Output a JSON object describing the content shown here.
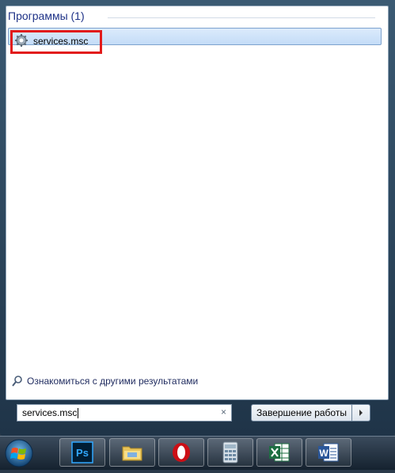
{
  "results": {
    "section_title": "Программы (1)",
    "items": [
      {
        "label": "services.msc",
        "icon": "services-gear-icon"
      }
    ]
  },
  "see_more": {
    "label": "Ознакомиться с другими результатами",
    "icon": "search-icon"
  },
  "search": {
    "value": "services.msc",
    "clear_icon": "×"
  },
  "shutdown": {
    "label": "Завершение работы",
    "arrow_icon": "chevron-right-icon"
  },
  "taskbar": {
    "apps": [
      {
        "name": "photoshop",
        "icon_text": "Ps"
      },
      {
        "name": "file-explorer"
      },
      {
        "name": "opera"
      },
      {
        "name": "calculator"
      },
      {
        "name": "excel"
      },
      {
        "name": "word",
        "icon_text": "W"
      }
    ]
  },
  "colors": {
    "highlight": "#e21b1b",
    "section_title": "#1e3287"
  }
}
